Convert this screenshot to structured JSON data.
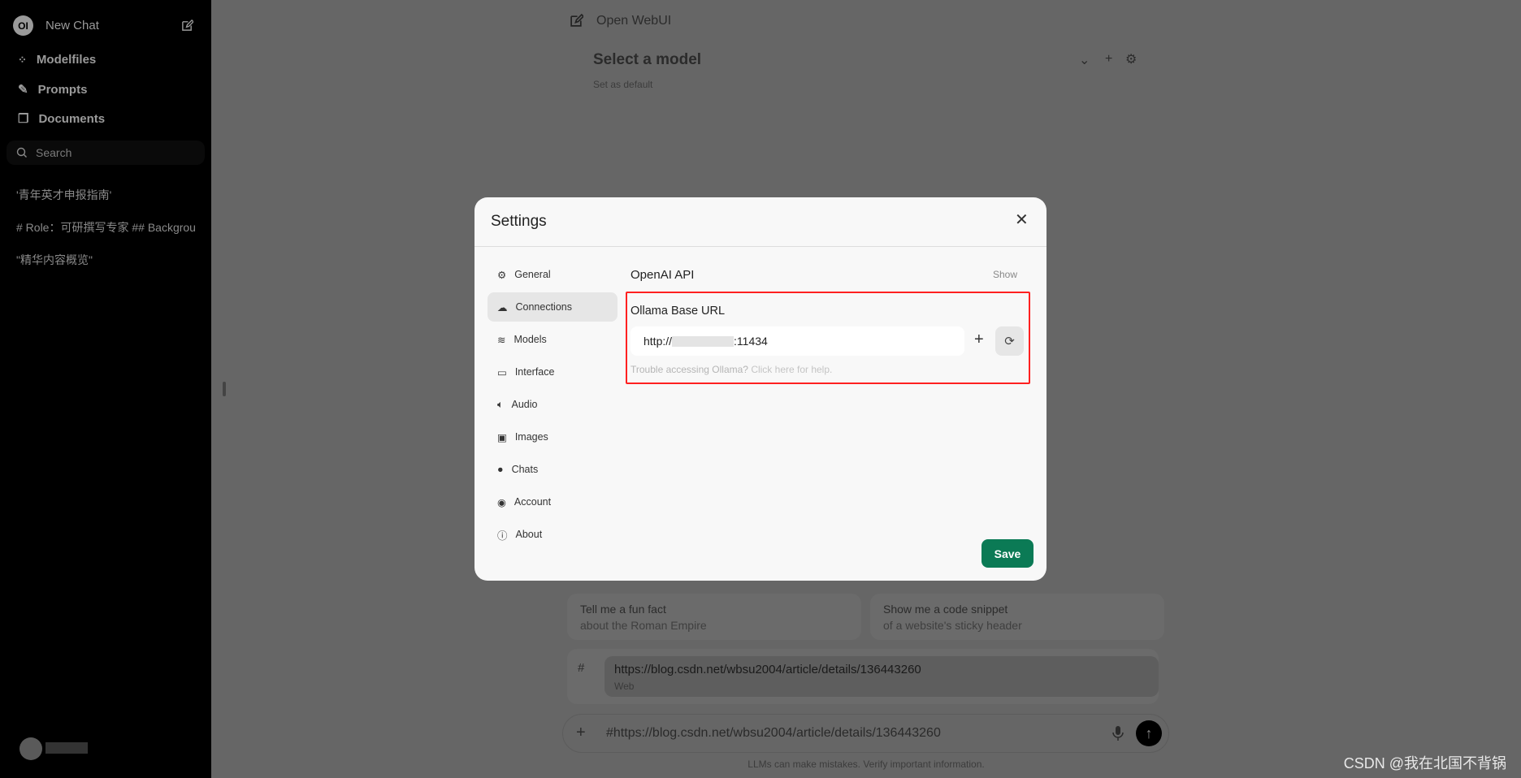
{
  "sidebar": {
    "new_chat": "New Chat",
    "items": [
      {
        "label": "Modelfiles",
        "icon": "modelfiles-icon"
      },
      {
        "label": "Prompts",
        "icon": "pencil-icon"
      },
      {
        "label": "Documents",
        "icon": "documents-icon"
      }
    ],
    "search_placeholder": "Search",
    "chats": [
      "'青年英才申报指南'",
      "# Role：可研撰写专家 ## Backgrou",
      "\"精华内容概览\""
    ]
  },
  "header": {
    "app_title": "Open WebUI",
    "model_select": "Select a model",
    "set_default": "Set as default"
  },
  "suggestions": [
    {
      "title": "Tell me a fun fact",
      "subtitle": "about the Roman Empire"
    },
    {
      "title": "Show me a code snippet",
      "subtitle": "of a website's sticky header"
    }
  ],
  "web_ref": {
    "hash": "#",
    "url": "https://blog.csdn.net/wbsu2004/article/details/136443260",
    "type": "Web"
  },
  "input": {
    "value": "#https://blog.csdn.net/wbsu2004/article/details/136443260"
  },
  "footer": "LLMs can make mistakes. Verify important information.",
  "watermark": "CSDN @我在北国不背锅",
  "settings": {
    "title": "Settings",
    "nav": [
      "General",
      "Connections",
      "Models",
      "Interface",
      "Audio",
      "Images",
      "Chats",
      "Account",
      "About"
    ],
    "active": "Connections",
    "openai_label": "OpenAI API",
    "show": "Show",
    "ollama_label": "Ollama Base URL",
    "ollama_url_prefix": "http://",
    "ollama_url_suffix": ":11434",
    "help_q": "Trouble accessing Ollama?",
    "help_link": "Click here for help.",
    "save": "Save",
    "highlight_color": "#ff2020",
    "save_color": "#0b7a55"
  }
}
